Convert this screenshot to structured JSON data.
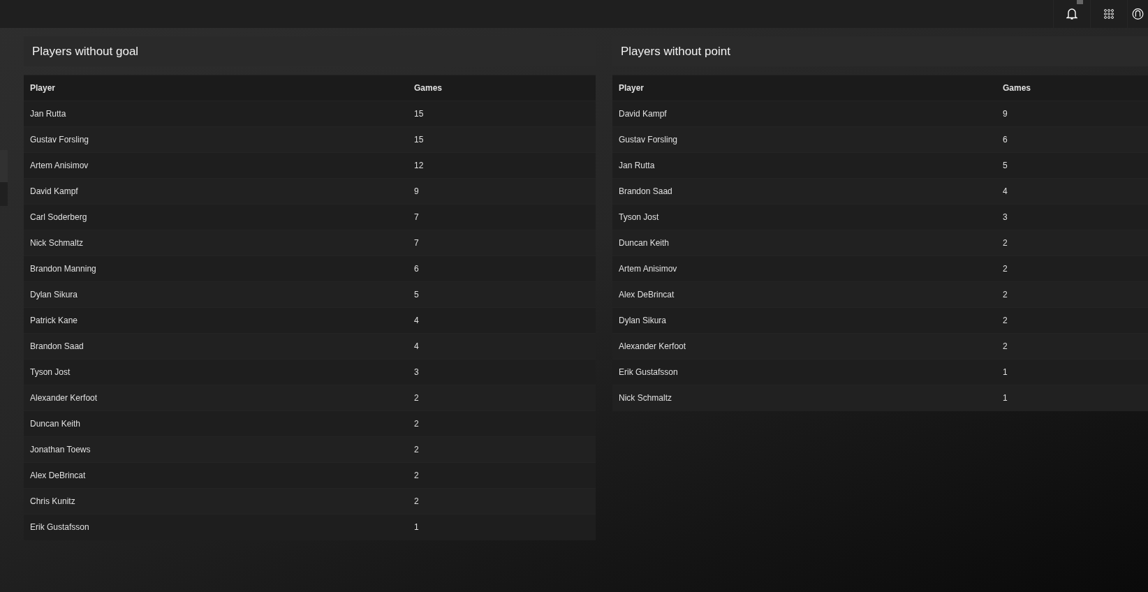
{
  "panels": [
    {
      "title": "Players without goal",
      "columns": [
        "Player",
        "Games"
      ],
      "rows": [
        [
          "Jan Rutta",
          "15"
        ],
        [
          "Gustav Forsling",
          "15"
        ],
        [
          "Artem Anisimov",
          "12"
        ],
        [
          "David Kampf",
          "9"
        ],
        [
          "Carl Soderberg",
          "7"
        ],
        [
          "Nick Schmaltz",
          "7"
        ],
        [
          "Brandon Manning",
          "6"
        ],
        [
          "Dylan Sikura",
          "5"
        ],
        [
          "Patrick Kane",
          "4"
        ],
        [
          "Brandon Saad",
          "4"
        ],
        [
          "Tyson Jost",
          "3"
        ],
        [
          "Alexander Kerfoot",
          "2"
        ],
        [
          "Duncan Keith",
          "2"
        ],
        [
          "Jonathan Toews",
          "2"
        ],
        [
          "Alex DeBrincat",
          "2"
        ],
        [
          "Chris Kunitz",
          "2"
        ],
        [
          "Erik Gustafsson",
          "1"
        ]
      ]
    },
    {
      "title": "Players without point",
      "columns": [
        "Player",
        "Games"
      ],
      "rows": [
        [
          "David Kampf",
          "9"
        ],
        [
          "Gustav Forsling",
          "6"
        ],
        [
          "Jan Rutta",
          "5"
        ],
        [
          "Brandon Saad",
          "4"
        ],
        [
          "Tyson Jost",
          "3"
        ],
        [
          "Duncan Keith",
          "2"
        ],
        [
          "Artem Anisimov",
          "2"
        ],
        [
          "Alex DeBrincat",
          "2"
        ],
        [
          "Dylan Sikura",
          "2"
        ],
        [
          "Alexander Kerfoot",
          "2"
        ],
        [
          "Erik Gustafsson",
          "1"
        ],
        [
          "Nick Schmaltz",
          "1"
        ]
      ]
    }
  ]
}
